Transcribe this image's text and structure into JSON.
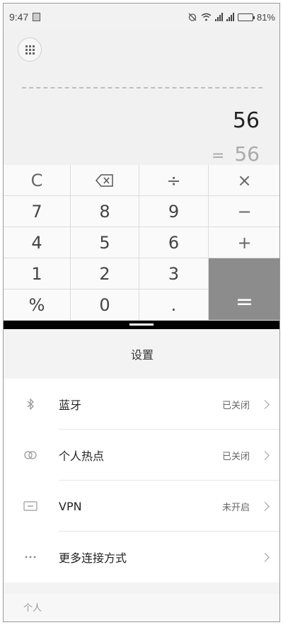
{
  "status_bar": {
    "time": "9:47",
    "battery": "81%",
    "battery_level": 0.81
  },
  "calculator": {
    "expression": "56",
    "result_equals": "=",
    "result": "56",
    "keys": [
      {
        "label": "C",
        "name": "clear-key"
      },
      {
        "label": "",
        "name": "delete-key",
        "icon": "backspace-icon"
      },
      {
        "label": "÷",
        "name": "divide-key"
      },
      {
        "label": "×",
        "name": "multiply-key"
      },
      {
        "label": "7",
        "name": "digit-7-key"
      },
      {
        "label": "8",
        "name": "digit-8-key"
      },
      {
        "label": "9",
        "name": "digit-9-key"
      },
      {
        "label": "−",
        "name": "minus-key"
      },
      {
        "label": "4",
        "name": "digit-4-key"
      },
      {
        "label": "5",
        "name": "digit-5-key"
      },
      {
        "label": "6",
        "name": "digit-6-key"
      },
      {
        "label": "+",
        "name": "plus-key"
      },
      {
        "label": "1",
        "name": "digit-1-key"
      },
      {
        "label": "2",
        "name": "digit-2-key"
      },
      {
        "label": "3",
        "name": "digit-3-key"
      },
      {
        "label": "%",
        "name": "percent-key"
      },
      {
        "label": "0",
        "name": "digit-0-key"
      },
      {
        "label": ".",
        "name": "decimal-key"
      },
      {
        "label": "=",
        "name": "equals-key"
      }
    ]
  },
  "settings": {
    "title": "设置",
    "items": [
      {
        "label": "蓝牙",
        "value": "已关闭",
        "icon": "bluetooth-icon"
      },
      {
        "label": "个人热点",
        "value": "已关闭",
        "icon": "hotspot-icon"
      },
      {
        "label": "VPN",
        "value": "未开启",
        "icon": "vpn-icon"
      },
      {
        "label": "更多连接方式",
        "value": "",
        "icon": "more-icon"
      }
    ],
    "section_personal": "个人"
  }
}
